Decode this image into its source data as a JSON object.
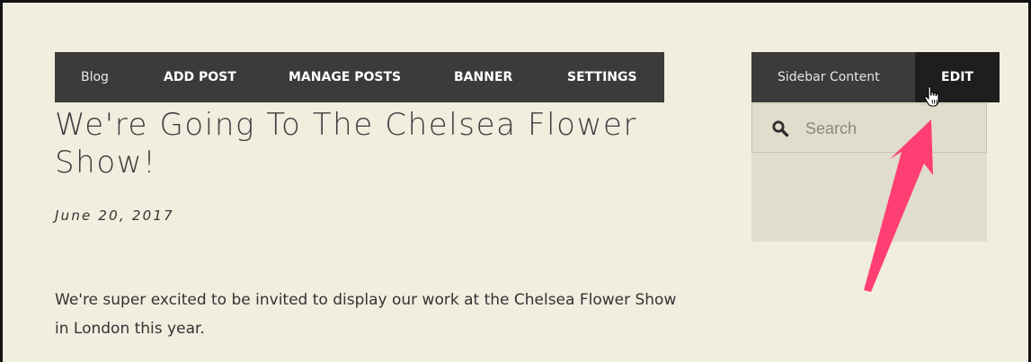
{
  "nav": {
    "blog": "Blog",
    "add_post": "ADD POST",
    "manage_posts": "MANAGE POSTS",
    "banner": "BANNER",
    "settings": "SETTINGS"
  },
  "sidebar": {
    "label": "Sidebar Content",
    "edit": "EDIT",
    "search_placeholder": "Search"
  },
  "post": {
    "title": "We're Going To The Chelsea Flower Show!",
    "date": "June 20, 2017",
    "body": "We're super excited to be invited to display our work at the Chelsea Flower Show in London this year."
  },
  "annotation": {
    "arrow_color": "#ff3f73",
    "icons": [
      "search-icon",
      "hand-cursor-icon",
      "annotation-arrow"
    ]
  },
  "colors": {
    "page_background": "#f1eddf",
    "nav_background": "#3b3b3b",
    "edit_background": "#1e1e1e",
    "sidebar_panel": "#e1ddcd"
  }
}
